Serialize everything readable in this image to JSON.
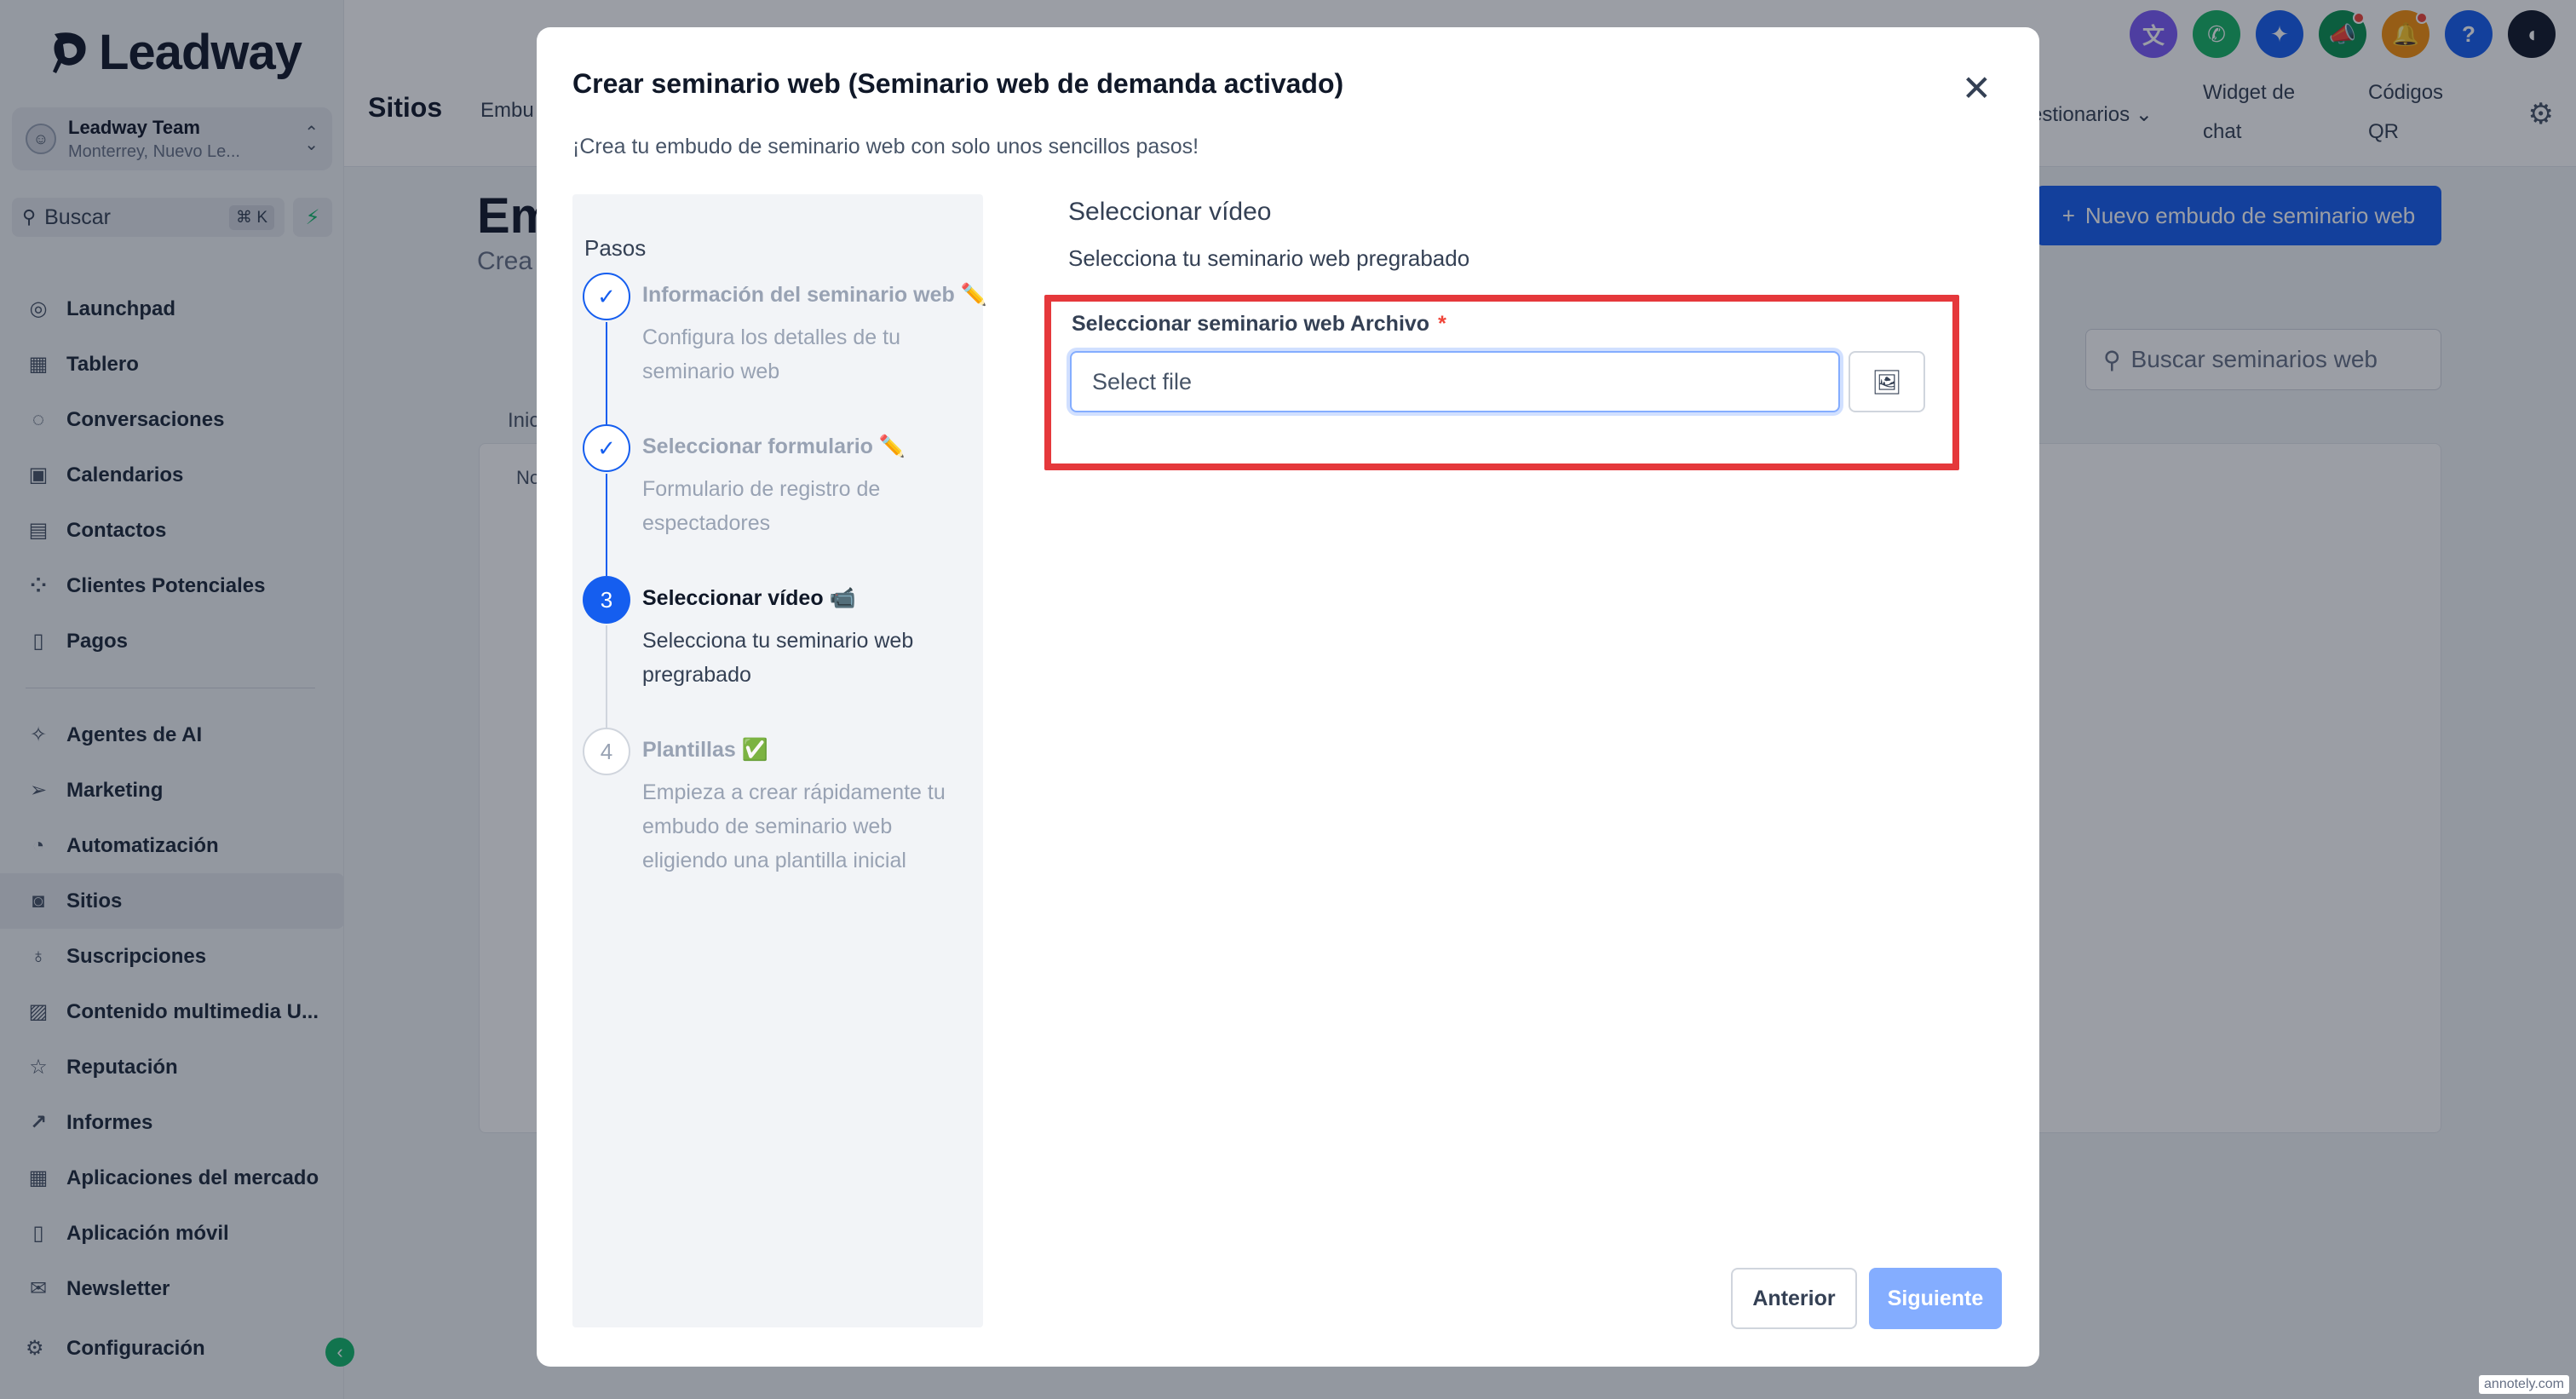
{
  "app": {
    "brand": "Leadway",
    "account_name": "Leadway Team",
    "account_location": "Monterrey, Nuevo Le...",
    "search_label": "Buscar",
    "search_shortcut": "⌘ K"
  },
  "sidebar": {
    "items": [
      {
        "label": "Launchpad",
        "icon": "rocket-icon"
      },
      {
        "label": "Tablero",
        "icon": "dashboard-icon"
      },
      {
        "label": "Conversaciones",
        "icon": "chat-icon"
      },
      {
        "label": "Calendarios",
        "icon": "calendar-icon"
      },
      {
        "label": "Contactos",
        "icon": "contacts-icon"
      },
      {
        "label": "Clientes Potenciales",
        "icon": "pipeline-icon"
      },
      {
        "label": "Pagos",
        "icon": "payments-icon"
      },
      {
        "label": "Agentes de AI",
        "icon": "ai-icon"
      },
      {
        "label": "Marketing",
        "icon": "send-icon"
      },
      {
        "label": "Automatización",
        "icon": "automation-icon"
      },
      {
        "label": "Sitios",
        "icon": "sites-icon"
      },
      {
        "label": "Suscripciones",
        "icon": "badge-icon"
      },
      {
        "label": "Contenido multimedia U...",
        "icon": "media-icon"
      },
      {
        "label": "Reputación",
        "icon": "star-icon"
      },
      {
        "label": "Informes",
        "icon": "chart-icon"
      },
      {
        "label": "Aplicaciones del mercado",
        "icon": "apps-icon"
      },
      {
        "label": "Aplicación móvil",
        "icon": "mobile-icon"
      },
      {
        "label": "Newsletter",
        "icon": "newsletter-icon"
      }
    ],
    "config_label": "Configuración"
  },
  "topbar": {
    "title": "Sitios",
    "tab_partial": "Embu",
    "tab_questionnaires": "estionarios",
    "tab_chat_widget_1": "Widget de",
    "tab_chat_widget_2": "chat",
    "tab_qr_1": "Códigos",
    "tab_qr_2": "QR"
  },
  "background": {
    "title_partial": "Em",
    "subtitle_partial": "Crea",
    "tab_partial": "Inic",
    "col_partial": "No",
    "new_button": "Nuevo embudo de seminario web",
    "search_placeholder": "Buscar seminarios web"
  },
  "modal": {
    "title": "Crear seminario web (Seminario web de demanda activado)",
    "subtitle": "¡Crea tu embudo de seminario web con solo unos sencillos pasos!",
    "steps_title": "Pasos",
    "steps": [
      {
        "number": "✓",
        "name": "Información del seminario web ✏️",
        "desc": "Configura los detalles de tu seminario web",
        "state": "done"
      },
      {
        "number": "✓",
        "name": "Seleccionar formulario ✏️",
        "desc": "Formulario de registro de espectadores",
        "state": "done"
      },
      {
        "number": "3",
        "name": "Seleccionar vídeo 📹",
        "desc": "Selecciona tu seminario web pregrabado",
        "state": "current"
      },
      {
        "number": "4",
        "name": "Plantillas ✅",
        "desc": "Empieza a crear rápidamente tu embudo de seminario web eligiendo una plantilla inicial",
        "state": "todo"
      }
    ],
    "section_title": "Seleccionar vídeo",
    "section_subtitle": "Selecciona tu seminario web pregrabado",
    "field_label": "Seleccionar seminario web Archivo",
    "field_required": "*",
    "file_placeholder": "Select file",
    "prev_button": "Anterior",
    "next_button": "Siguiente"
  },
  "colors": {
    "primary": "#155eef",
    "highlight_border": "#e5383b",
    "next_disabled": "#84adff"
  },
  "watermark": "annotely.com"
}
